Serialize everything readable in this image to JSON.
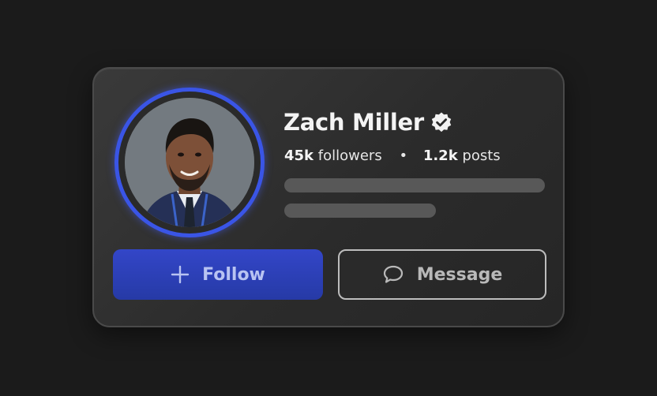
{
  "profile": {
    "name": "Zach Miller",
    "verified": true,
    "followers_count": "45k",
    "followers_label": "followers",
    "separator": "•",
    "posts_count": "1.2k",
    "posts_label": "posts"
  },
  "actions": {
    "follow_label": "Follow",
    "follow_icon": "plus-icon",
    "message_label": "Message",
    "message_icon": "chat-bubble-icon"
  },
  "colors": {
    "background": "#1b1b1b",
    "card": "#2f2f2f",
    "accent_ring": "#3a55e6",
    "follow_button": "#2f42bd",
    "verified_badge": "#f2f2f2"
  }
}
